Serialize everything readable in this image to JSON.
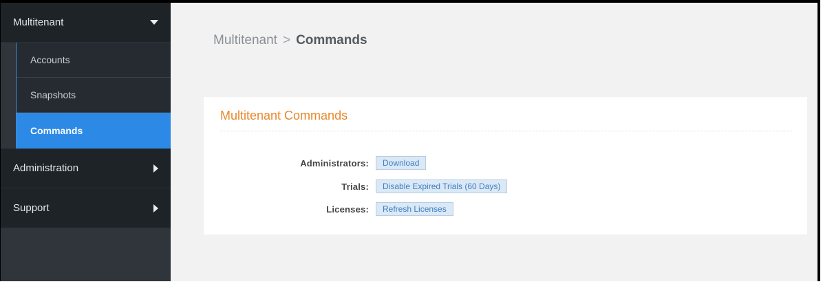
{
  "sidebar": {
    "sections": [
      {
        "label": "Multitenant",
        "expanded": true
      },
      {
        "label": "Administration",
        "expanded": false
      },
      {
        "label": "Support",
        "expanded": false
      }
    ],
    "items": [
      {
        "label": "Accounts"
      },
      {
        "label": "Snapshots"
      },
      {
        "label": "Commands",
        "active": true
      }
    ]
  },
  "breadcrumb": {
    "parent": "Multitenant",
    "separator": ">",
    "current": "Commands"
  },
  "panel": {
    "title": "Multitenant Commands",
    "commands": [
      {
        "label": "Administrators:",
        "button": "Download"
      },
      {
        "label": "Trials:",
        "button": "Disable Expired Trials (60 Days)"
      },
      {
        "label": "Licenses:",
        "button": "Refresh Licenses"
      }
    ]
  },
  "colors": {
    "accent": "#2c8ae6",
    "title_orange": "#e8872a",
    "sidebar_dark": "#1e2328"
  }
}
